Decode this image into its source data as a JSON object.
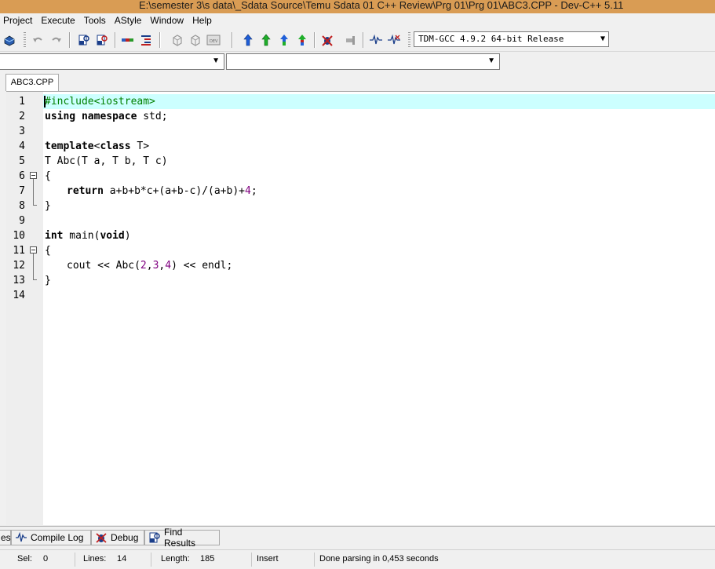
{
  "window": {
    "title": "E:\\semester 3\\s data\\_Sdata Source\\Temu Sdata 01 C++ Review\\Prg 01\\Prg 01\\ABC3.CPP - Dev-C++ 5.11"
  },
  "menu": [
    "Project",
    "Execute",
    "Tools",
    "AStyle",
    "Window",
    "Help"
  ],
  "toolbar": {
    "compiler": "TDM-GCC 4.9.2 64-bit Release",
    "icons": [
      "project-icon",
      "undo-icon",
      "redo-icon",
      "find-icon",
      "replace-icon",
      "insert-icon",
      "indent-icon",
      "unindent-icon",
      "toggle-bookmark-icon",
      "goto-bookmark-icon",
      "dev-icon",
      "compile-icon",
      "run-icon",
      "compile-run-icon",
      "rebuild-icon",
      "debug-icon",
      "stop-icon",
      "profile-icon",
      "profile-delete-icon"
    ]
  },
  "editor": {
    "tab": "ABC3.CPP",
    "lines": [
      {
        "n": "1"
      },
      {
        "n": "2"
      },
      {
        "n": "3"
      },
      {
        "n": "4"
      },
      {
        "n": "5"
      },
      {
        "n": "6"
      },
      {
        "n": "7"
      },
      {
        "n": "8"
      },
      {
        "n": "9"
      },
      {
        "n": "10"
      },
      {
        "n": "11"
      },
      {
        "n": "12"
      },
      {
        "n": "13"
      },
      {
        "n": "14"
      }
    ],
    "code": {
      "l1": "#include<iostream>",
      "l2_kw": "using namespace",
      "l2_rest": " std;",
      "l4_kw1": "template",
      "l4_mid": "<",
      "l4_kw2": "class",
      "l4_rest": " T>",
      "l5": "T Abc(T a, T b, T c)",
      "l6": "{",
      "l7_kw": "return",
      "l7_rest": " a+b+b*c+(a+b-c)/(a+b)+",
      "l7_num": "4",
      "l7_end": ";",
      "l8": "}",
      "l10_kw1": "int",
      "l10_mid": " main(",
      "l10_kw2": "void",
      "l10_end": ")",
      "l11": "{",
      "l12_a": "cout << Abc(",
      "l12_n1": "2",
      "l12_c1": ",",
      "l12_n2": "3",
      "l12_c2": ",",
      "l12_n3": "4",
      "l12_b": ") << endl;",
      "l13": "}"
    }
  },
  "bottom_tabs": {
    "partial": "es",
    "compile_log": "Compile Log",
    "debug": "Debug",
    "find_results": "Find Results"
  },
  "status": {
    "sel_label": "Sel:",
    "sel_value": "0",
    "lines_label": "Lines:",
    "lines_value": "14",
    "length_label": "Length:",
    "length_value": "185",
    "mode": "Insert",
    "message": "Done parsing in 0,453 seconds"
  }
}
